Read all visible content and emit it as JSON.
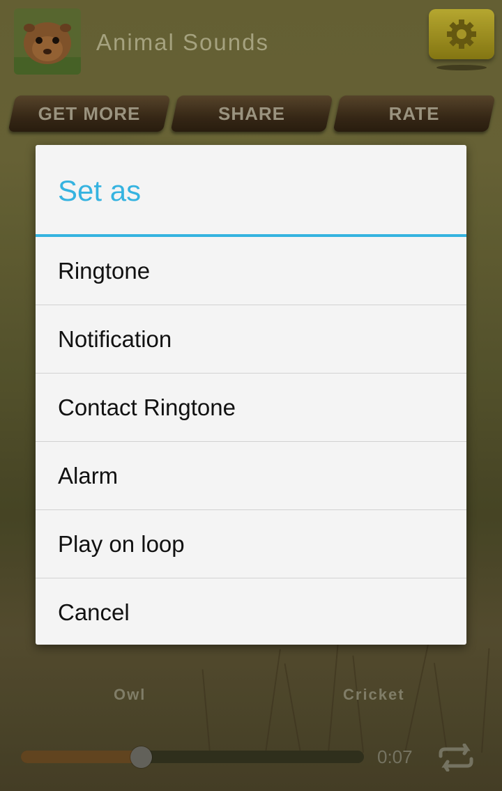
{
  "app": {
    "title": "Animal Sounds",
    "icon": "guinea-pig-photo",
    "settings_icon": "gear-icon"
  },
  "toolbar": {
    "buttons": [
      "GET MORE",
      "SHARE",
      "RATE"
    ]
  },
  "sounds": {
    "visible_labels": [
      "Owl",
      "Cricket"
    ]
  },
  "player": {
    "elapsed": "0:07",
    "progress": 0.35,
    "repeat_icon": "repeat-icon"
  },
  "dialog": {
    "title": "Set as",
    "options": [
      "Ringtone",
      "Notification",
      "Contact Ringtone",
      "Alarm",
      "Play on loop",
      "Cancel"
    ]
  },
  "colors": {
    "dialog_accent": "#35b3e0",
    "settings_button": "#b3a22b",
    "toolbar_button": "#3e2d19"
  }
}
